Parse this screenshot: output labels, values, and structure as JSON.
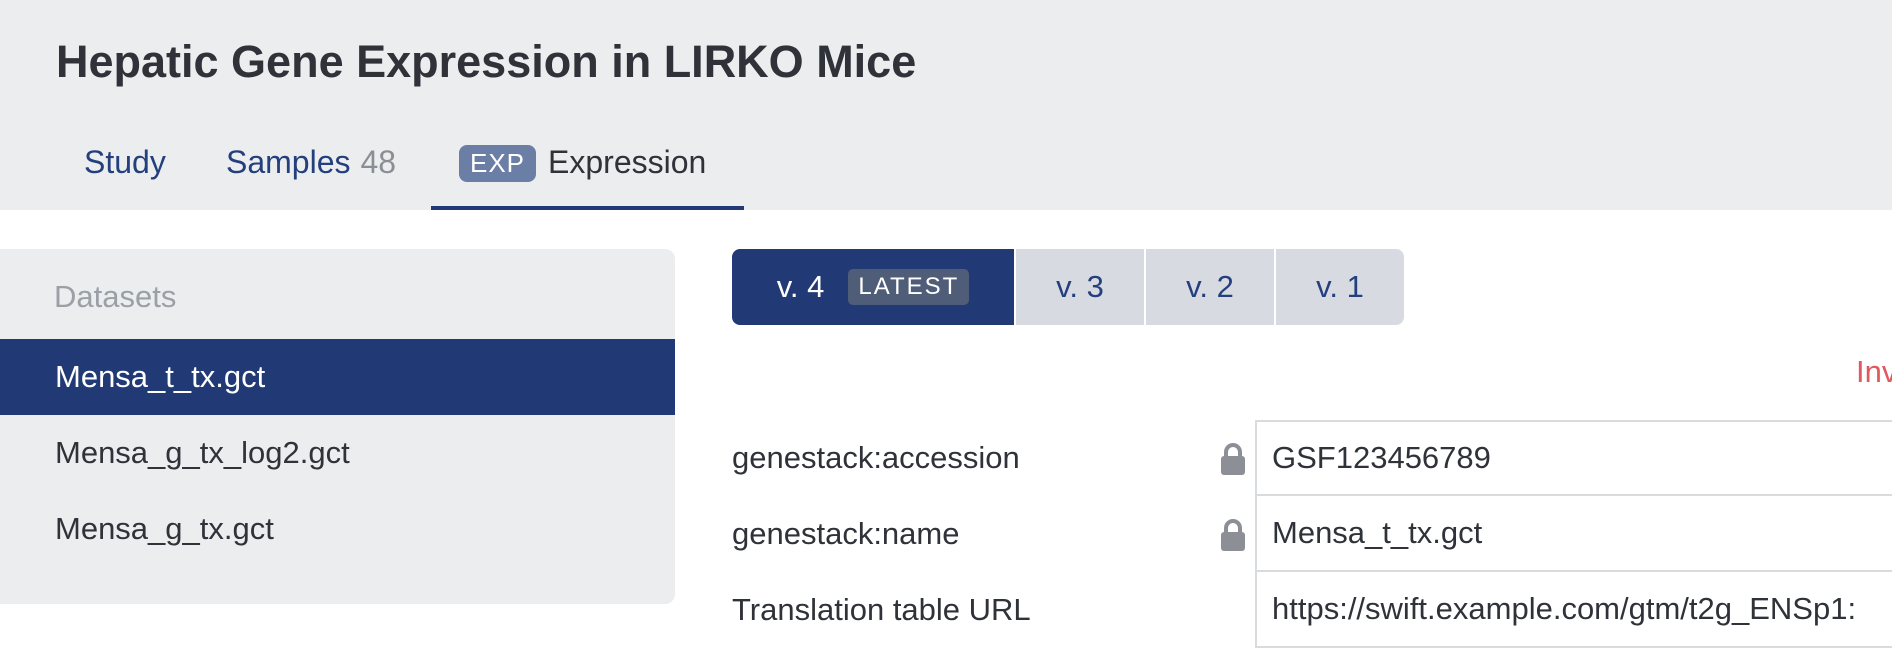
{
  "page": {
    "title": "Hepatic Gene Expression in LIRKO Mice"
  },
  "tabs": {
    "study": {
      "label": "Study"
    },
    "samples": {
      "label": "Samples",
      "count": "48"
    },
    "expression": {
      "badge": "EXP",
      "label": "Expression",
      "active": true
    }
  },
  "sidebar": {
    "heading": "Datasets",
    "items": [
      {
        "label": "Mensa_t_tx.gct",
        "active": true
      },
      {
        "label": "Mensa_g_tx_log2.gct",
        "active": false
      },
      {
        "label": "Mensa_g_tx.gct",
        "active": false
      }
    ]
  },
  "versions": [
    {
      "label": "v. 4",
      "badge": "LATEST",
      "active": true
    },
    {
      "label": "v. 3",
      "active": false
    },
    {
      "label": "v. 2",
      "active": false
    },
    {
      "label": "v. 1",
      "active": false
    }
  ],
  "notice": {
    "text": "Inv"
  },
  "fields": [
    {
      "label": "genestack:accession",
      "value": "GSF123456789",
      "locked": true,
      "icon": "lock-icon"
    },
    {
      "label": "genestack:name",
      "value": "Mensa_t_tx.gct",
      "locked": true,
      "icon": "lock-icon"
    },
    {
      "label": "Translation table URL",
      "value": "https://swift.example.com/gtm/t2g_ENSp1:",
      "locked": false
    }
  ],
  "colors": {
    "primary": "#213a75",
    "header_bg": "#ecedef",
    "link": "#243f7d",
    "error": "#e0595f"
  }
}
